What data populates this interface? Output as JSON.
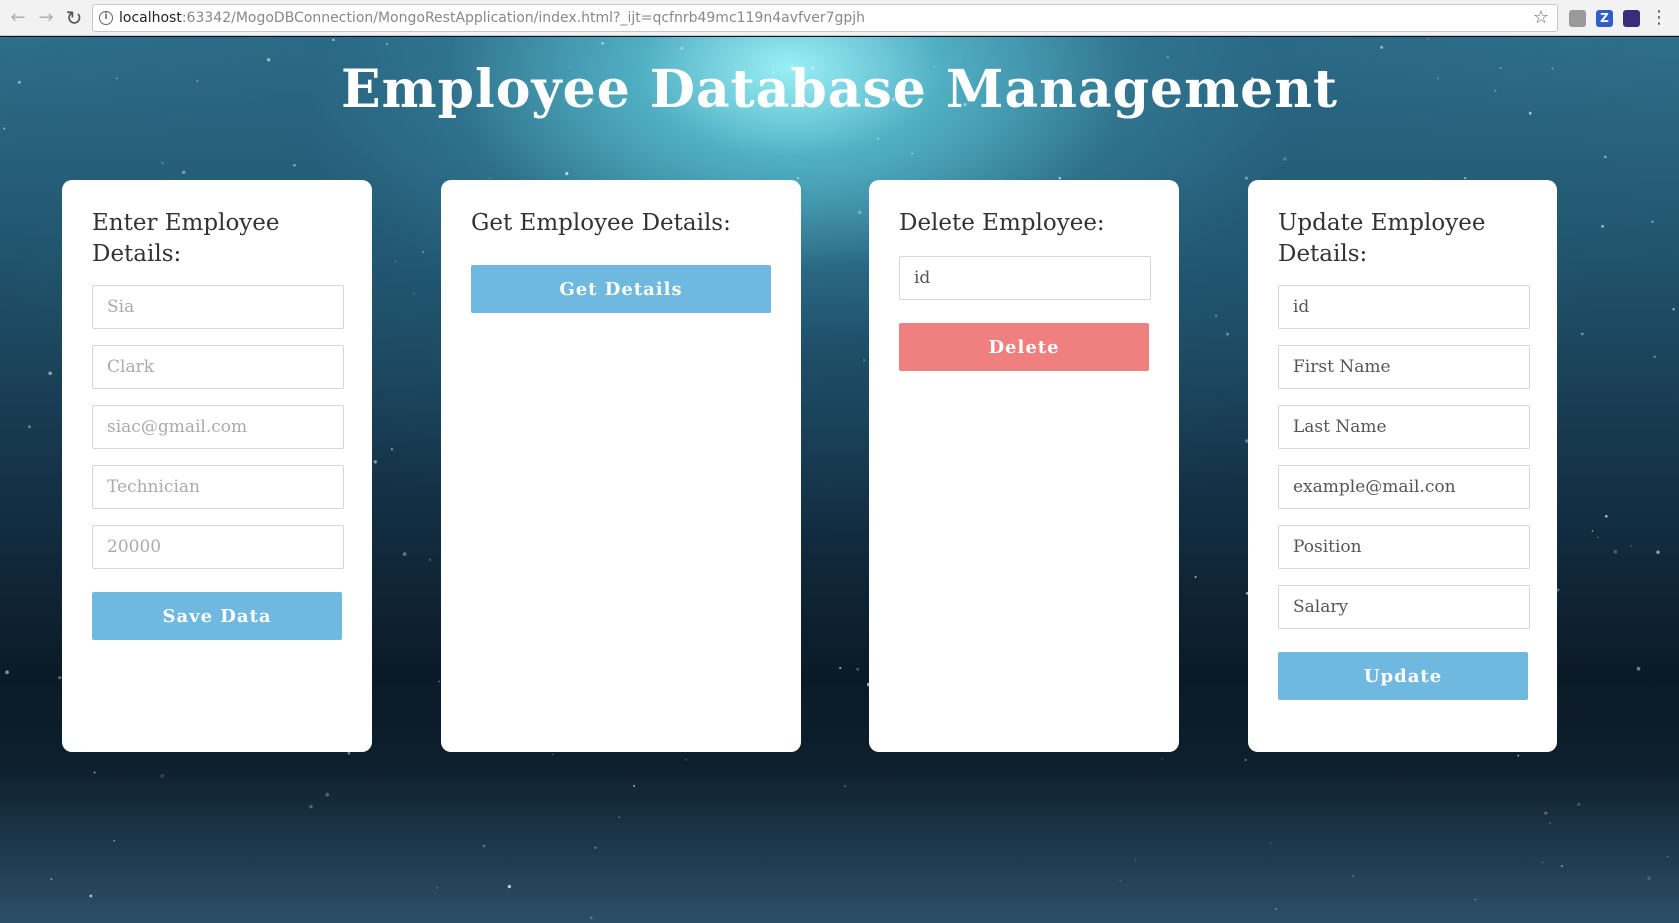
{
  "browser": {
    "url_host": "localhost",
    "url_rest": ":63342/MogoDBConnection/MongoRestApplication/index.html?_ijt=qcfnrb49mc119n4avfver7gpjh",
    "back_icon": "arrow-left-icon",
    "forward_icon": "arrow-right-icon",
    "reload_icon": "reload-icon",
    "star_icon": "star-icon",
    "menu_icon": "kebab-menu-icon",
    "ext2_letter": "Z"
  },
  "page": {
    "title": "Employee Database Management"
  },
  "cards": {
    "enter": {
      "title": "Enter Employee Details:",
      "placeholders": [
        "Sia",
        "Clark",
        "siac@gmail.com",
        "Technician",
        "20000"
      ],
      "button": "Save Data",
      "button_color": "#6fb8df"
    },
    "get": {
      "title": "Get Employee Details:",
      "button": "Get Details",
      "button_color": "#6fb8df"
    },
    "delete": {
      "title": "Delete Employee:",
      "placeholders": [
        "id"
      ],
      "button": "Delete",
      "button_color": "#f08080"
    },
    "update": {
      "title": "Update Employee Details:",
      "placeholders": [
        "id",
        "First Name",
        "Last Name",
        "example@mail.con",
        "Position",
        "Salary"
      ],
      "button": "Update",
      "button_color": "#6fb8df"
    }
  }
}
